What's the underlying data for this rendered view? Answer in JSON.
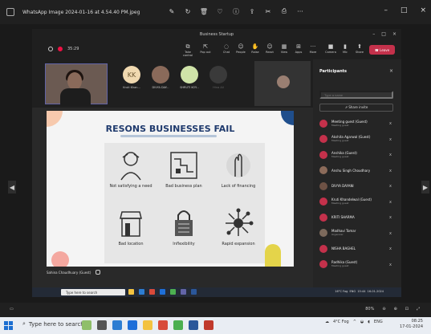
{
  "viewer": {
    "title": "WhatsApp Image 2024-01-16 at 4.54.40 PM.jpeg",
    "more": "···"
  },
  "teams": {
    "window_title": "Business Startup",
    "timer": "35:29",
    "toolbar": [
      "Take control",
      "Pop out",
      "Chat",
      "People",
      "Raise",
      "React",
      "View",
      "Apps",
      "More",
      "Camera",
      "Mic",
      "Share"
    ],
    "leave_label": "Leave",
    "tiles": [
      {
        "initials": "KK",
        "label": "Kruti Khan..."
      },
      {
        "initials": "",
        "label": "DIVYA DAY..."
      },
      {
        "initials": "",
        "label": "SHRUTI KOY..."
      },
      {
        "initials": "",
        "label": "Hina Ali"
      }
    ],
    "caller_label": "Sahina Chaudhuary (Guest)"
  },
  "slide": {
    "title": "RESONS BUSINESSES FAIL",
    "reasons": [
      "Not satisfying a need",
      "Bad business plan",
      "Lack of financing",
      "Bad location",
      "Inflexibility",
      "Rapid expansion"
    ]
  },
  "participants": {
    "heading": "Participants",
    "search_placeholder": "Type a name",
    "share_invite": "Share invite",
    "people": [
      {
        "name": "Meeting guest (Guest)",
        "role": "Meeting guest",
        "color": "#c4314b"
      },
      {
        "name": "Akshita Agarwal (Guest)",
        "role": "Meeting guest",
        "color": "#c4314b"
      },
      {
        "name": "Anshika (Guest)",
        "role": "Meeting guest",
        "color": "#c4314b"
      },
      {
        "name": "Anshu Singh Choudhary",
        "role": "",
        "color": "#8c6b5a"
      },
      {
        "name": "DIVYA DAYANI",
        "role": "",
        "color": "#6e5245"
      },
      {
        "name": "Kruti Khandelwal (Guest)",
        "role": "Meeting guest",
        "color": "#c4314b"
      },
      {
        "name": "KRITI SHARMA",
        "role": "",
        "color": "#c4314b"
      },
      {
        "name": "Madhavi Tomar",
        "role": "Organizer",
        "color": "#7d6a5c"
      },
      {
        "name": "NISHA BAGHEL",
        "role": "",
        "color": "#c4314b"
      },
      {
        "name": "Radhika (Guest)",
        "role": "Meeting guest",
        "color": "#c4314b"
      }
    ]
  },
  "inner_taskbar": {
    "search": "Type here to search",
    "weather": "16°C Fog",
    "lang": "ENG",
    "time": "15:44",
    "date": "16-01-2024"
  },
  "status": {
    "zoom": "80%"
  },
  "taskbar": {
    "search": "Type here to search",
    "weather": "4°C Fog",
    "lang": "ENG",
    "time": "08:25",
    "date": "17-01-2024"
  }
}
